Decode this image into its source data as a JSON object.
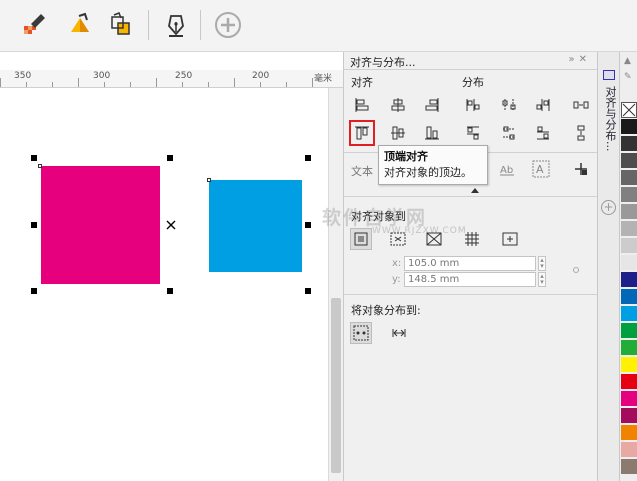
{
  "toolbar": {
    "icons": [
      "fill-icon",
      "eyedropper-icon",
      "paint-bucket-icon",
      "smart-fill-icon",
      "pen-tool-icon",
      "add-icon"
    ]
  },
  "ruler": {
    "labels": [
      "350",
      "300",
      "250",
      "200",
      "毫米"
    ]
  },
  "canvas": {
    "shapes": [
      {
        "name": "magenta-rectangle",
        "color": "#e6007e"
      },
      {
        "name": "blue-rectangle",
        "color": "#009fe3"
      }
    ]
  },
  "docker": {
    "title": "对齐与分布...",
    "align_label": "对齐",
    "distribute_label": "分布",
    "text_label": "文本",
    "align_to_label": "对齐对象到",
    "x_field": {
      "prefix": "x:",
      "value": "105.0 mm"
    },
    "y_field": {
      "prefix": "y:",
      "value": "148.5 mm"
    },
    "distribute_to_label": "将对象分布到:",
    "tab_label": "对齐与分布..."
  },
  "tooltip": {
    "title": "顶端对齐",
    "description": "对齐对象的顶边。"
  },
  "palette": {
    "colors": [
      "#ffffff",
      "#1a1a1a",
      "#333333",
      "#4d4d4d",
      "#666666",
      "#808080",
      "#999999",
      "#b3b3b3",
      "#cccccc",
      "#e6e6e6",
      "#1d2088",
      "#0068b7",
      "#009fe3",
      "#00a040",
      "#22ac38",
      "#fff100",
      "#e60012",
      "#e4007f",
      "#a40b5d",
      "#f08300",
      "#e8a9a5",
      "#8b7b6e"
    ]
  },
  "watermark": {
    "main": "软件自学网",
    "sub": "WWW.RJZXW.COM"
  }
}
